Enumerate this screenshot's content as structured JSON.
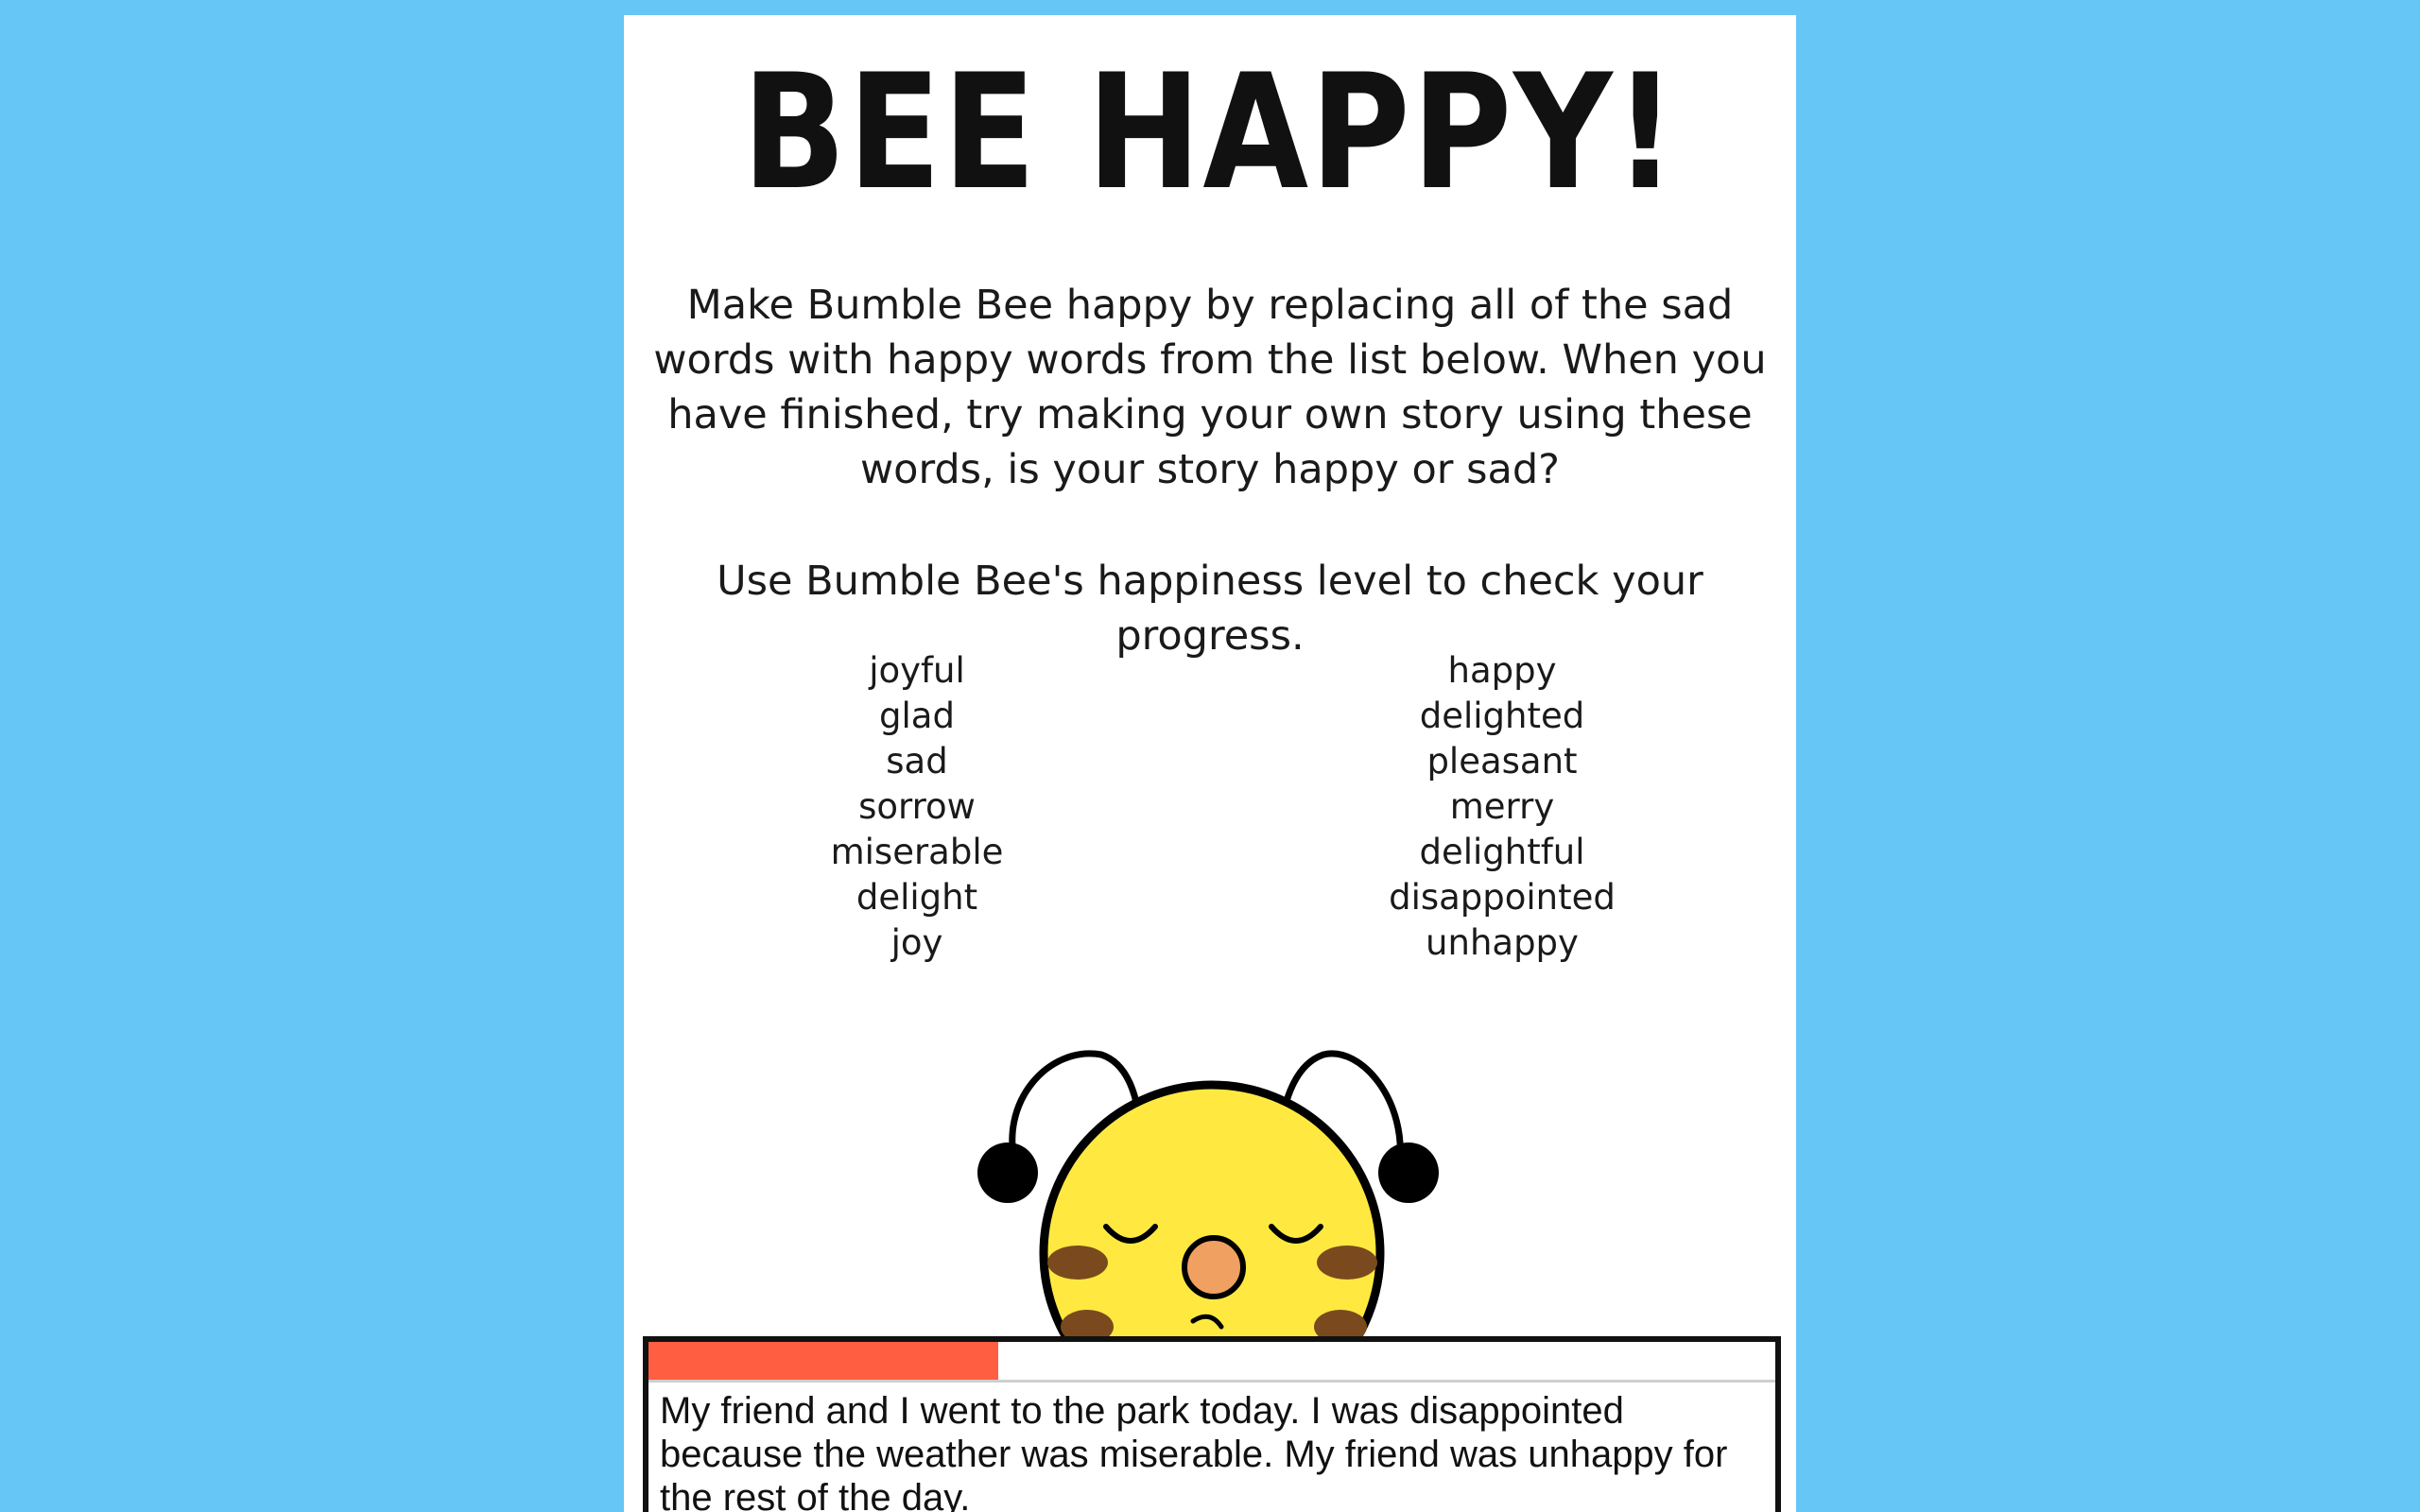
{
  "page": {
    "title": "BEE HAPPY!",
    "intro": "Make Bumble Bee happy by replacing all of the sad words with happy words from the list below. When you have finished, try making your own story using these words, is your story happy or sad?",
    "progress_hint": "Use Bumble Bee's happiness level to check your progress."
  },
  "word_list": {
    "left": [
      "joyful",
      "glad",
      "sad",
      "sorrow",
      "miserable",
      "delight",
      "joy"
    ],
    "right": [
      "happy",
      "delighted",
      "pleasant",
      "merry",
      "delightful",
      "disappointed",
      "unhappy"
    ]
  },
  "happiness_meter": {
    "level_percent": 31,
    "fill_color": "#ff5e41"
  },
  "story": {
    "text": "My friend and I went to the park today. I was disappointed because the weather was miserable. My friend was unhappy for the rest of the day."
  },
  "colors": {
    "background": "#66c6f5",
    "bee_body": "#ffe940",
    "bee_nose": "#f0a060",
    "bee_stripe": "#7a4a1e"
  }
}
